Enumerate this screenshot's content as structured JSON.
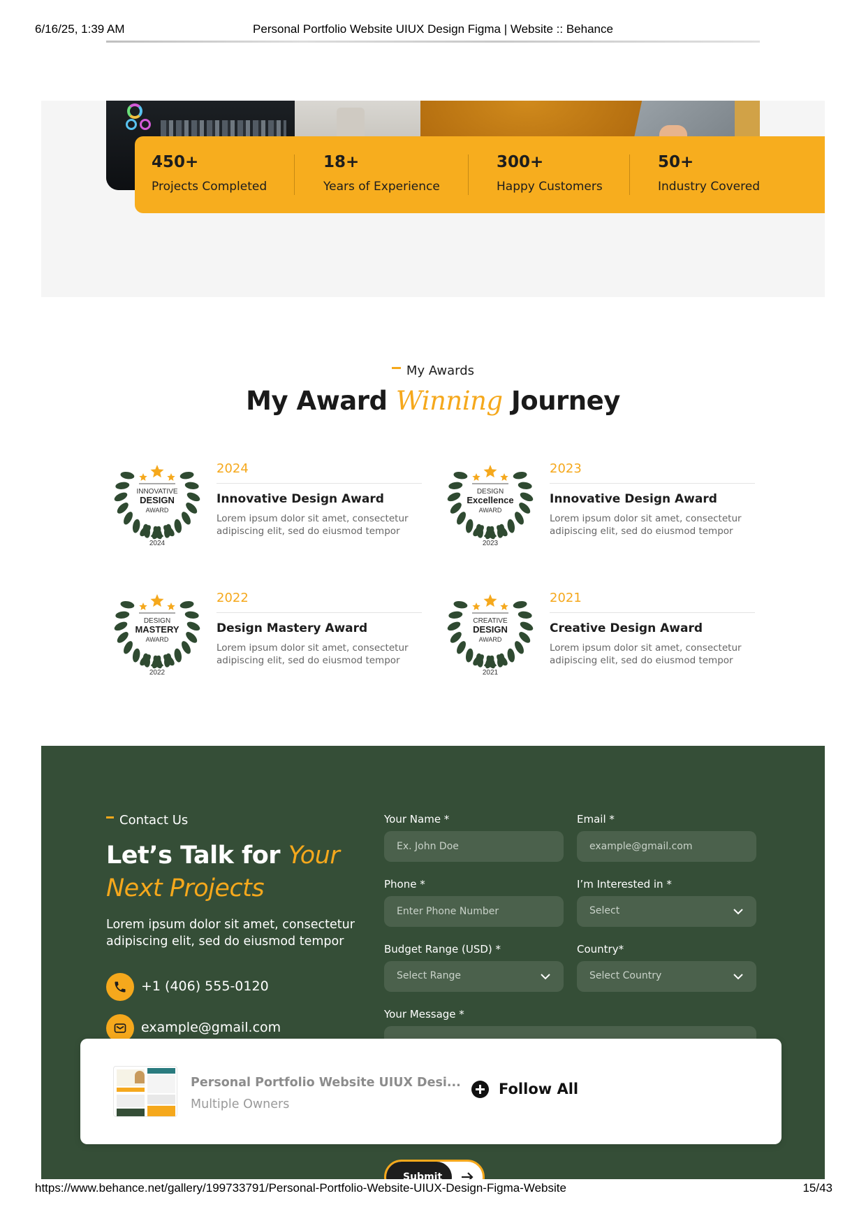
{
  "print": {
    "date": "6/16/25, 1:39 AM",
    "title": "Personal Portfolio Website UIUX Design Figma | Website :: Behance",
    "url": "https://www.behance.net/gallery/199733791/Personal-Portfolio-Website-UIUX-Design-Figma-Website",
    "page": "15/43"
  },
  "stats": [
    {
      "value": "450+",
      "label": "Projects Completed"
    },
    {
      "value": "18+",
      "label": "Years of Experience"
    },
    {
      "value": "300+",
      "label": "Happy Customers"
    },
    {
      "value": "50+",
      "label": "Industry Covered"
    }
  ],
  "awards": {
    "eyebrow": "My Awards",
    "title_pre": "My Award",
    "title_accent": "Winning",
    "title_post": "Journey",
    "items": [
      {
        "year": "2024",
        "name": "Innovative Design Award",
        "desc": "Lorem ipsum dolor sit amet, consectetur adipiscing elit, sed do eiusmod tempor",
        "badge_top": "INNOVATIVE",
        "badge_main": "DESIGN",
        "badge_bottom": "AWARD",
        "badge_year": "2024"
      },
      {
        "year": "2023",
        "name": "Innovative Design Award",
        "desc": "Lorem ipsum dolor sit amet, consectetur adipiscing elit, sed do eiusmod tempor",
        "badge_top": "DESIGN",
        "badge_main": "Excellence",
        "badge_bottom": "AWARD",
        "badge_year": "2023"
      },
      {
        "year": "2022",
        "name": "Design Mastery Award",
        "desc": "Lorem ipsum dolor sit amet, consectetur adipiscing elit, sed do eiusmod tempor",
        "badge_top": "DESIGN",
        "badge_main": "MASTERY",
        "badge_bottom": "AWARD",
        "badge_year": "2022"
      },
      {
        "year": "2021",
        "name": "Creative Design Award",
        "desc": "Lorem ipsum dolor sit amet, consectetur adipiscing elit, sed do eiusmod tempor",
        "badge_top": "CREATIVE",
        "badge_main": "DESIGN",
        "badge_bottom": "AWARD",
        "badge_year": "2021"
      }
    ]
  },
  "contact": {
    "eyebrow": "Contact Us",
    "headline_line1_pre": "Let’s Talk for",
    "headline_line1_accent": "Your",
    "headline_line2_accent": "Next Projects",
    "lead": "Lorem ipsum dolor sit amet, consectetur adipiscing elit, sed do eiusmod tempor",
    "phone": "+1 (406) 555-0120",
    "email": "example@gmail.com",
    "form": {
      "name_label": "Your Name *",
      "name_placeholder": "Ex. John Doe",
      "email_label": "Email *",
      "email_placeholder": "example@gmail.com",
      "phone_label": "Phone *",
      "phone_placeholder": "Enter Phone Number",
      "interest_label": "I’m Interested in *",
      "interest_value": "Select",
      "budget_label": "Budget Range (USD) *",
      "budget_value": "Select Range",
      "country_label": "Country*",
      "country_value": "Select Country",
      "message_label": "Your Message *",
      "submit_label": "Submit"
    }
  },
  "overlay": {
    "project_title": "Personal Portfolio Website UIUX Desi...",
    "owners": "Multiple Owners",
    "follow_label": "Follow All"
  },
  "colors": {
    "accent": "#f5a81c",
    "green": "#354e37",
    "field": "#4b614c"
  }
}
